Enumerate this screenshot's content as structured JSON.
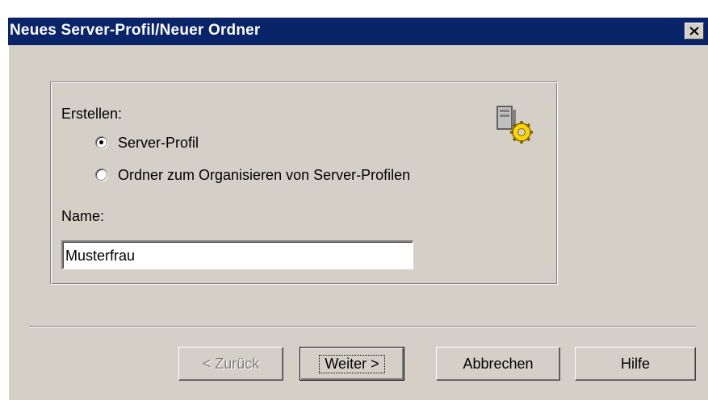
{
  "window": {
    "title": "Neues Server-Profil/Neuer Ordner"
  },
  "group": {
    "create_label": "Erstellen:",
    "options": [
      {
        "label": "Server-Profil",
        "selected": true
      },
      {
        "label": "Ordner zum Organisieren von Server-Profilen",
        "selected": false
      }
    ],
    "name_label": "Name:",
    "name_value": "Musterfrau"
  },
  "buttons": {
    "back": "< Zurück",
    "next": "Weiter >",
    "cancel": "Abbrechen",
    "help": "Hilfe"
  },
  "icons": {
    "server_profile": "server-gear-icon",
    "close": "close-icon"
  },
  "colors": {
    "titlebar": "#0a246a",
    "face": "#d4d0c8"
  }
}
